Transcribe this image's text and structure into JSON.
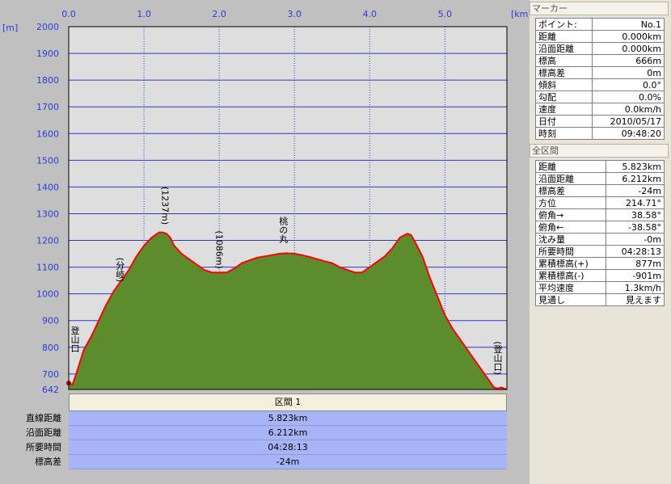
{
  "chart_data": {
    "type": "area",
    "x_unit_label": "[km]",
    "y_unit_label": "[m]",
    "xlim": [
      0,
      5.823
    ],
    "ylim": [
      642,
      2000
    ],
    "x_ticks": [
      "0.0",
      "1.0",
      "2.0",
      "3.0",
      "4.0",
      "5.0"
    ],
    "y_ticks": [
      "2000",
      "1900",
      "1800",
      "1700",
      "1600",
      "1500",
      "1400",
      "1300",
      "1200",
      "1100",
      "1000",
      "900",
      "800",
      "700",
      "642"
    ],
    "grid": true,
    "series": [
      {
        "x": [
          0.0,
          0.05,
          0.1,
          0.2,
          0.3,
          0.4,
          0.5,
          0.6,
          0.7,
          0.8,
          0.9,
          1.0,
          1.1,
          1.2,
          1.25,
          1.3,
          1.35,
          1.4,
          1.5,
          1.6,
          1.7,
          1.8,
          1.9,
          2.0,
          2.1,
          2.2,
          2.3,
          2.4,
          2.5,
          2.6,
          2.7,
          2.8,
          2.9,
          3.0,
          3.1,
          3.2,
          3.3,
          3.4,
          3.5,
          3.6,
          3.7,
          3.8,
          3.9,
          4.0,
          4.1,
          4.2,
          4.3,
          4.4,
          4.5,
          4.55,
          4.6,
          4.7,
          4.8,
          4.9,
          5.0,
          5.1,
          5.2,
          5.3,
          5.4,
          5.5,
          5.6,
          5.65,
          5.7,
          5.75,
          5.823
        ],
        "y": [
          666,
          660,
          700,
          790,
          840,
          900,
          960,
          1010,
          1050,
          1090,
          1140,
          1180,
          1210,
          1230,
          1230,
          1225,
          1210,
          1180,
          1150,
          1130,
          1110,
          1090,
          1080,
          1080,
          1080,
          1095,
          1115,
          1125,
          1135,
          1140,
          1145,
          1150,
          1152,
          1150,
          1145,
          1138,
          1130,
          1122,
          1115,
          1100,
          1090,
          1080,
          1080,
          1100,
          1120,
          1140,
          1170,
          1210,
          1225,
          1220,
          1195,
          1140,
          1060,
          990,
          920,
          870,
          830,
          790,
          750,
          710,
          670,
          650,
          645,
          650,
          642
        ]
      }
    ],
    "annotations": [
      {
        "text": "登山口",
        "x": 0.08,
        "y": 830
      },
      {
        "text": "(分岐)",
        "x": 0.68,
        "y": 1090
      },
      {
        "text": "(1237m)",
        "x": 1.28,
        "y": 1330
      },
      {
        "text": "(1086m)",
        "x": 2.0,
        "y": 1165
      },
      {
        "text": "桃の丸",
        "x": 2.85,
        "y": 1240
      },
      {
        "text": "(登山口)",
        "x": 5.7,
        "y": 760
      }
    ],
    "colors": {
      "fill": "#5c8c2c",
      "line": "#ff0000",
      "grid": "#2c3ac8",
      "plot_bg": "#dedede",
      "label": "#2a3bd6"
    }
  },
  "section": {
    "header": "区間 1",
    "rows": [
      {
        "label": "直線距離",
        "value": "5.823km"
      },
      {
        "label": "沿面距離",
        "value": "6.212km"
      },
      {
        "label": "所要時間",
        "value": "04:28:13"
      },
      {
        "label": "標高差",
        "value": "-24m"
      }
    ]
  },
  "panel": {
    "marker_header": "マーカー",
    "marker_rows": [
      {
        "label": "ポイント:",
        "value": "No.1"
      },
      {
        "label": "距離",
        "value": "0.000km"
      },
      {
        "label": "沿面距離",
        "value": "0.000km"
      },
      {
        "label": "標高",
        "value": "666m"
      },
      {
        "label": "標高差",
        "value": "0m"
      },
      {
        "label": "傾斜",
        "value": "0.0°"
      },
      {
        "label": "勾配",
        "value": "0.0%"
      },
      {
        "label": "速度",
        "value": "0.0km/h"
      },
      {
        "label": "日付",
        "value": "2010/05/17"
      },
      {
        "label": "時刻",
        "value": "09:48:20"
      }
    ],
    "all_header": "全区間",
    "all_rows": [
      {
        "label": "距離",
        "value": "5.823km"
      },
      {
        "label": "沿面距離",
        "value": "6.212km"
      },
      {
        "label": "標高差",
        "value": "-24m"
      },
      {
        "label": "方位",
        "value": "214.71°"
      },
      {
        "label": "俯角→",
        "value": "38.58°"
      },
      {
        "label": "俯角←",
        "value": "-38.58°"
      },
      {
        "label": "沈み量",
        "value": "-0m"
      },
      {
        "label": "所要時間",
        "value": "04:28:13"
      },
      {
        "label": "累積標高(+)",
        "value": "877m"
      },
      {
        "label": "累積標高(-)",
        "value": "-901m"
      },
      {
        "label": "平均速度",
        "value": "1.3km/h"
      },
      {
        "label": "見通し",
        "value": "見えます"
      }
    ]
  }
}
